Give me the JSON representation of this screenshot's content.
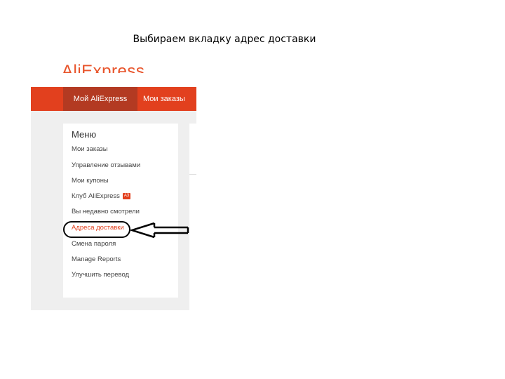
{
  "caption": "Выбираем вкладку адрес доставки",
  "logo": "AliExpress",
  "nav": {
    "tabs": [
      {
        "label": "Мой AliExpress",
        "active": true
      },
      {
        "label": "Мои заказы",
        "active": false
      }
    ]
  },
  "menu": {
    "title": "Меню",
    "items": [
      "Мои заказы",
      "Управление отзывами",
      "Мои купоны",
      "Клуб AliExpress",
      "Вы недавно смотрели",
      "Адреса доставки",
      "Смена пароля",
      "Manage Reports",
      "Улучшить перевод"
    ],
    "club_badge": "A3",
    "highlighted_index": 5
  },
  "colors": {
    "brand": "#e2401e",
    "active_tab": "#b33a22",
    "annotation": "#000000"
  }
}
